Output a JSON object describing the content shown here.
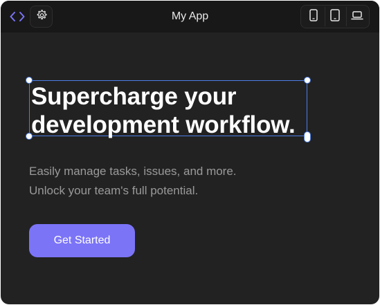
{
  "app": {
    "title": "My App"
  },
  "toolbar": {
    "left_icons": [
      "code-icon",
      "gear-icon"
    ],
    "device_icons": [
      "phone-icon",
      "tablet-icon",
      "laptop-icon"
    ],
    "accent_color": "#7b74f7"
  },
  "hero": {
    "headline_line1": "Supercharge your",
    "headline_line2": "development workflow.",
    "subtext_line1": "Easily manage tasks, issues, and more.",
    "subtext_line2": "Unlock your team's full potential.",
    "cta_label": "Get Started"
  },
  "selection": {
    "color": "#4c7ee6"
  }
}
